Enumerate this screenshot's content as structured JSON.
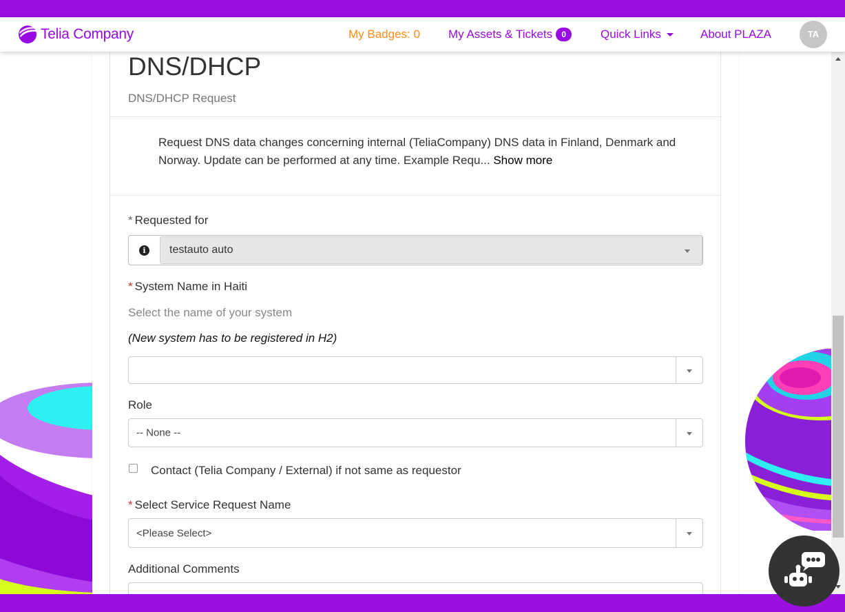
{
  "brand": {
    "name": "Telia Company",
    "color": "#990ae3"
  },
  "nav": {
    "badges": "My Badges: 0",
    "assets": "My Assets & Tickets",
    "assets_count": "0",
    "quick_links": "Quick Links",
    "about": "About PLAZA",
    "avatar_initials": "TA"
  },
  "form": {
    "title": "DNS/DHCP",
    "subtitle": "DNS/DHCP Request",
    "description": "Request DNS data changes concerning internal (TeliaCompany) DNS data in Finland, Denmark and Norway. Update can be performed at any time. Example Requ...",
    "show_more": "Show more",
    "requested_for": {
      "label": "Requested for",
      "value": "testauto auto"
    },
    "system_name": {
      "label": "System Name in Haiti",
      "help": "Select the name of your system",
      "note": "(New system  has to be registered in H2)",
      "value": ""
    },
    "role": {
      "label": "Role",
      "value": "-- None --"
    },
    "contact": {
      "label": "Contact (Telia Company / External) if not same as requestor",
      "checked": false
    },
    "service_request": {
      "label": "Select Service Request Name",
      "value": "<Please Select>"
    },
    "additional_comments": {
      "label": "Additional Comments"
    },
    "mandatory_marker": "*"
  },
  "icons": {
    "info": "info-circle-icon",
    "dropdown": "triangle-down-icon",
    "chatbot": "chatbot-robot-icon",
    "menu_caret": "caret-down-icon"
  }
}
